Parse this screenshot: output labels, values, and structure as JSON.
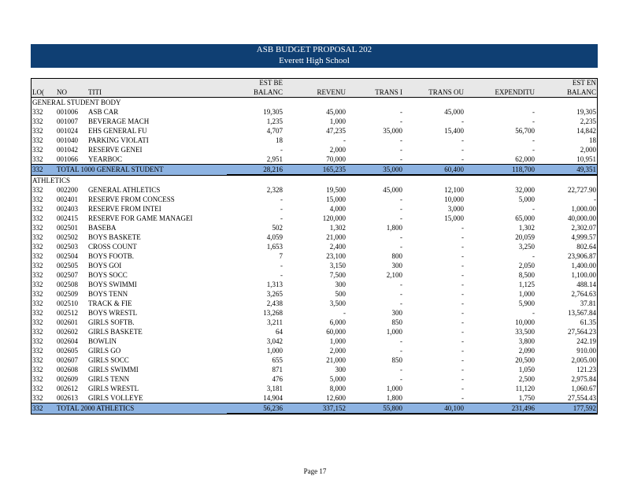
{
  "header": {
    "title": "ASB BUDGET PROPOSAL 202",
    "school": "Everett High School"
  },
  "columns": [
    {
      "line1": "",
      "line2": "LO("
    },
    {
      "line1": "",
      "line2": "NO"
    },
    {
      "line1": "",
      "line2": "TITI"
    },
    {
      "line1": "EST BE",
      "line2": "BALANC"
    },
    {
      "line1": "",
      "line2": "REVENU"
    },
    {
      "line1": "",
      "line2": "TRANS I"
    },
    {
      "line1": "",
      "line2": "TRANS OU"
    },
    {
      "line1": "",
      "line2": "EXPENDITU"
    },
    {
      "line1": "EST EN",
      "line2": "BALANC"
    }
  ],
  "sections": [
    {
      "title": "GENERAL STUDENT BODY",
      "rows": [
        [
          "332",
          "001006",
          "ASB CAR",
          "19,305",
          "45,000",
          "-",
          "45,000",
          "-",
          "19,305"
        ],
        [
          "332",
          "001007",
          "BEVERAGE MACH",
          "1,235",
          "1,000",
          "-",
          "-",
          "-",
          "2,235"
        ],
        [
          "332",
          "001024",
          "EHS GENERAL FU",
          "4,707",
          "47,235",
          "35,000",
          "15,400",
          "56,700",
          "14,842"
        ],
        [
          "332",
          "001040",
          "PARKING VIOLATI",
          "18",
          "-",
          "-",
          "-",
          "-",
          "18"
        ],
        [
          "332",
          "001042",
          "RESERVE GENEI",
          "-",
          "2,000",
          "-",
          "-",
          "-",
          "2,000"
        ],
        [
          "332",
          "001066",
          "YEARBOC",
          "2,951",
          "70,000",
          "-",
          "-",
          "62,000",
          "10,951"
        ]
      ],
      "total": [
        "332",
        "TOTAL 1000 GENERAL STUDENT",
        "28,216",
        "165,235",
        "35,000",
        "60,400",
        "118,700",
        "49,351"
      ]
    },
    {
      "title": "ATHLETICS",
      "rows": [
        [
          "332",
          "002200",
          "GENERAL ATHLETICS",
          "2,328",
          "19,500",
          "45,000",
          "12,100",
          "32,000",
          "22,727.90"
        ],
        [
          "332",
          "002401",
          "RESERVE FROM CONCESS",
          "-",
          "15,000",
          "-",
          "10,000",
          "5,000",
          "-"
        ],
        [
          "332",
          "002403",
          "RESERVE FROM INTEI",
          "-",
          "4,000",
          "-",
          "3,000",
          "-",
          "1,000.00"
        ],
        [
          "332",
          "002415",
          "RESERVE FOR GAME MANAGEI",
          "-",
          "120,000",
          "-",
          "15,000",
          "65,000",
          "40,000.00"
        ],
        [
          "332",
          "002501",
          "BASEBA",
          "502",
          "1,302",
          "1,800",
          "-",
          "1,302",
          "2,302.07"
        ],
        [
          "332",
          "002502",
          "BOYS BASKETE",
          "4,059",
          "21,000",
          "-",
          "-",
          "20,059",
          "4,999.57"
        ],
        [
          "332",
          "002503",
          "CROSS COUNT",
          "1,653",
          "2,400",
          "-",
          "-",
          "3,250",
          "802.64"
        ],
        [
          "332",
          "002504",
          "BOYS FOOTB.",
          "7",
          "23,100",
          "800",
          "-",
          "-",
          "23,906.87"
        ],
        [
          "332",
          "002505",
          "BOYS GOI",
          "-",
          "3,150",
          "300",
          "-",
          "2,050",
          "1,400.00"
        ],
        [
          "332",
          "002507",
          "BOYS SOCC",
          "-",
          "7,500",
          "2,100",
          "-",
          "8,500",
          "1,100.00"
        ],
        [
          "332",
          "002508",
          "BOYS SWIMMI",
          "1,313",
          "300",
          "-",
          "-",
          "1,125",
          "488.14"
        ],
        [
          "332",
          "002509",
          "BOYS TENN",
          "3,265",
          "500",
          "-",
          "-",
          "1,000",
          "2,764.63"
        ],
        [
          "332",
          "002510",
          "TRACK & FIE",
          "2,438",
          "3,500",
          "-",
          "-",
          "5,900",
          "37.81"
        ],
        [
          "332",
          "002512",
          "BOYS WRESTL",
          "13,268",
          "-",
          "300",
          "-",
          "-",
          "13,567.84"
        ],
        [
          "332",
          "002601",
          "GIRLS SOFTB.",
          "3,211",
          "6,000",
          "850",
          "-",
          "10,000",
          "61.35"
        ],
        [
          "332",
          "002602",
          "GIRLS BASKETE",
          "64",
          "60,000",
          "1,000",
          "-",
          "33,500",
          "27,564.23"
        ],
        [
          "332",
          "002604",
          "BOWLIN",
          "3,042",
          "1,000",
          "-",
          "-",
          "3,800",
          "242.19"
        ],
        [
          "332",
          "002605",
          "GIRLS GO",
          "1,000",
          "2,000",
          "-",
          "-",
          "2,090",
          "910.00"
        ],
        [
          "332",
          "002607",
          "GIRLS SOCC",
          "655",
          "21,000",
          "850",
          "-",
          "20,500",
          "2,005.00"
        ],
        [
          "332",
          "002608",
          "GIRLS SWIMMI",
          "871",
          "300",
          "-",
          "-",
          "1,050",
          "121.23"
        ],
        [
          "332",
          "002609",
          "GIRLS TENN",
          "476",
          "5,000",
          "-",
          "-",
          "2,500",
          "2,975.84"
        ],
        [
          "332",
          "002612",
          "GIRLS WRESTL",
          "3,181",
          "8,000",
          "1,000",
          "-",
          "11,120",
          "1,060.67"
        ],
        [
          "332",
          "002613",
          "GIRLS VOLLEYE",
          "14,904",
          "12,600",
          "1,800",
          "-",
          "1,750",
          "27,554.43"
        ]
      ],
      "total": [
        "332",
        "TOTAL 2000 ATHLETICS",
        "56,236",
        "337,152",
        "55,800",
        "40,100",
        "231,496",
        "177,592"
      ]
    }
  ],
  "footer": {
    "page_label": "Page 17"
  }
}
